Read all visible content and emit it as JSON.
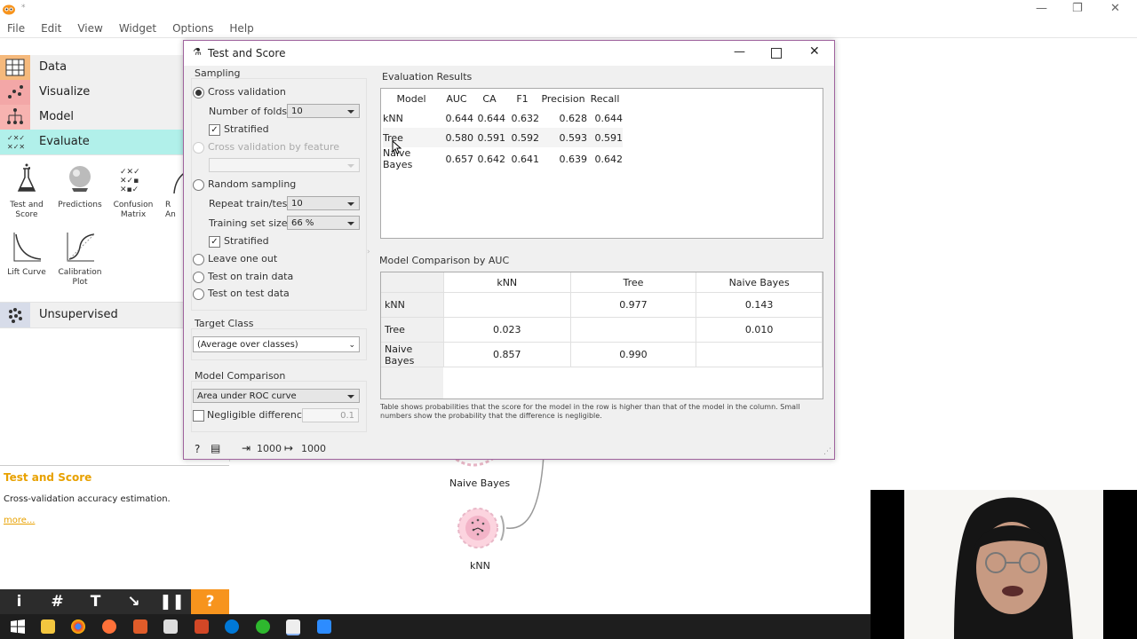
{
  "app": {
    "menu": [
      "File",
      "Edit",
      "View",
      "Widget",
      "Options",
      "Help"
    ]
  },
  "toolbox": {
    "categories": [
      {
        "label": "Data",
        "color": "#f5b97c"
      },
      {
        "label": "Visualize",
        "color": "#f3a7a7"
      },
      {
        "label": "Model",
        "color": "#f7b3b0"
      },
      {
        "label": "Evaluate",
        "color": "#b1f0ea"
      },
      {
        "label": "Unsupervised",
        "color": "#d7dce9"
      }
    ],
    "tools": [
      "Test and Score",
      "Predictions",
      "Confusion Matrix",
      "R An",
      "Lift Curve",
      "Calibration Plot"
    ]
  },
  "help": {
    "title": "Test and Score",
    "description": "Cross-validation accuracy estimation.",
    "more": "more..."
  },
  "canvas": {
    "nodes": [
      "Naive Bayes",
      "kNN"
    ]
  },
  "dialog": {
    "title": "Test and Score",
    "sampling": {
      "title": "Sampling",
      "cross_validation": "Cross validation",
      "folds_label": "Number of folds:",
      "folds_value": "10",
      "stratified": "Stratified",
      "cv_by_feature": "Cross validation by feature",
      "random_sampling": "Random sampling",
      "repeat_label": "Repeat train/test:",
      "repeat_value": "10",
      "train_size_label": "Training set size:",
      "train_size_value": "66 %",
      "stratified2": "Stratified",
      "leave_one_out": "Leave one out",
      "test_on_train": "Test on train data",
      "test_on_test": "Test on test data"
    },
    "target": {
      "title": "Target Class",
      "value": "(Average over classes)"
    },
    "model_comparison": {
      "title": "Model Comparison",
      "value": "Area under ROC curve",
      "negligible_label": "Negligible difference:",
      "negligible_value": "0.1"
    },
    "status": {
      "in_count": "1000",
      "out_count": "1000"
    },
    "evaluation": {
      "title": "Evaluation Results",
      "headers": [
        "Model",
        "AUC",
        "CA",
        "F1",
        "Precision",
        "Recall"
      ],
      "rows": [
        [
          "kNN",
          "0.644",
          "0.644",
          "0.632",
          "0.628",
          "0.644"
        ],
        [
          "Tree",
          "0.580",
          "0.591",
          "0.592",
          "0.593",
          "0.591"
        ],
        [
          "Naive Bayes",
          "0.657",
          "0.642",
          "0.641",
          "0.639",
          "0.642"
        ]
      ]
    },
    "comparison": {
      "title": "Model Comparison by AUC",
      "headers": [
        "kNN",
        "Tree",
        "Naive Bayes"
      ],
      "rows": [
        {
          "label": "kNN",
          "cells": [
            "",
            "0.977",
            "0.143"
          ]
        },
        {
          "label": "Tree",
          "cells": [
            "0.023",
            "",
            "0.010"
          ]
        },
        {
          "label": "Naive Bayes",
          "cells": [
            "0.857",
            "0.990",
            ""
          ]
        }
      ],
      "note": "Table shows probabilities that the score for the model in the row is higher than that of the model in the column. Small numbers show the probability that the difference is negligible."
    }
  }
}
